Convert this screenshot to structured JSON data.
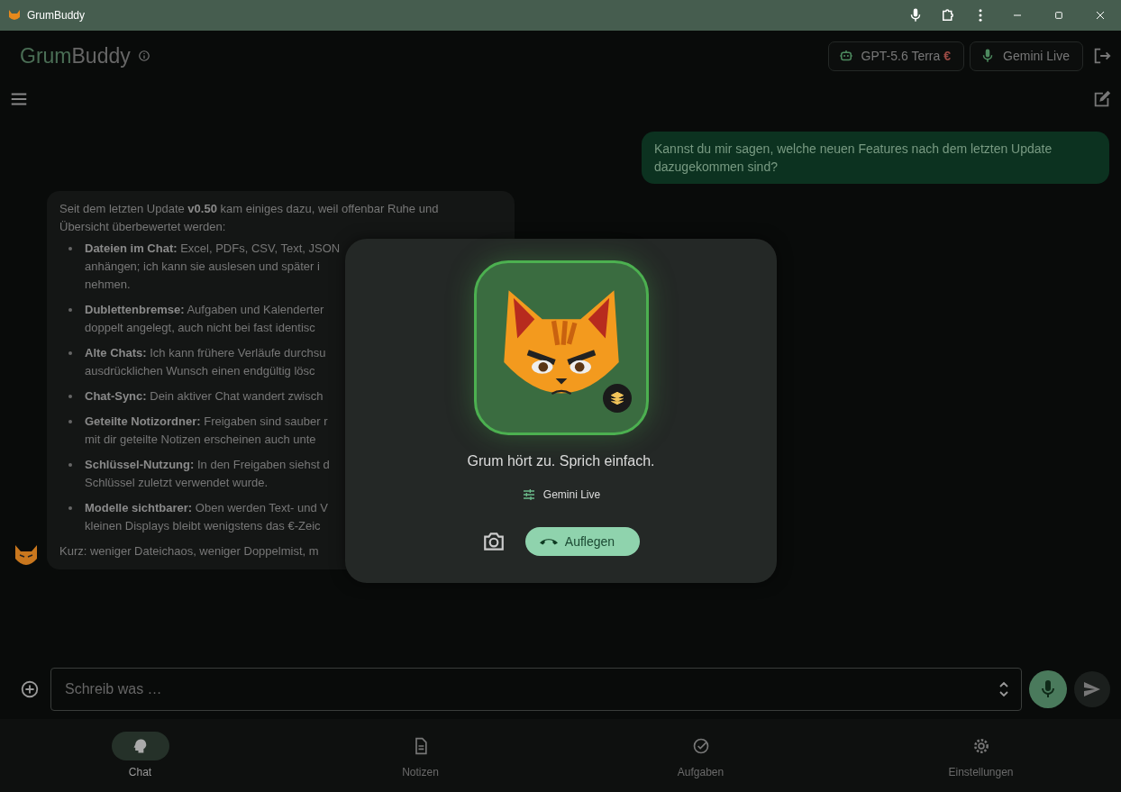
{
  "window": {
    "title": "GrumBuddy"
  },
  "header": {
    "logo_first": "Grum",
    "logo_second": "Buddy",
    "model_chip": {
      "label": "GPT-5.6 Terra",
      "currency": "€"
    },
    "voice_chip": {
      "label": "Gemini Live"
    }
  },
  "chat": {
    "user_message": "Kannst du mir sagen, welche neuen Features nach dem letzten Update dazugekommen sind?",
    "bot_message": {
      "intro": [
        "Seit dem letzten Update **v0.50** kam einiges dazu, weil offenbar Ruhe und",
        "Übersicht überbewertet werden:"
      ],
      "items": [
        {
          "lines": [
            "**Dateien im Chat:** Excel, PDFs, CSV, Text, JSON",
            "anhängen; ich kann sie auslesen und später i",
            "nehmen."
          ]
        },
        {
          "lines": [
            "**Dublettenbremse:** Aufgaben und Kalenderter",
            "doppelt angelegt, auch nicht bei fast identisc"
          ]
        },
        {
          "lines": [
            "**Alte Chats:** Ich kann frühere Verläufe durchsu",
            "ausdrücklichen Wunsch einen endgültig lösc"
          ]
        },
        {
          "lines": [
            "**Chat-Sync:** Dein aktiver Chat wandert zwisch"
          ]
        },
        {
          "lines": [
            "**Geteilte Notizordner:** Freigaben sind sauber r",
            "mit dir geteilte Notizen erscheinen auch unte"
          ]
        },
        {
          "lines": [
            "**Schlüssel-Nutzung:** In den Freigaben siehst d",
            "Schlüssel zuletzt verwendet wurde."
          ]
        },
        {
          "lines": [
            "**Modelle sichtbarer:** Oben werden Text- und V",
            "kleinen Displays bleibt wenigstens das €-Zeic"
          ]
        }
      ],
      "outro": "Kurz: weniger Dateichaos, weniger Doppelmist, m"
    }
  },
  "voice_dialog": {
    "status": "Grum hört zu. Sprich einfach.",
    "model": "Gemini Live",
    "hangup": "Auflegen"
  },
  "composer": {
    "placeholder": "Schreib was …"
  },
  "nav": [
    {
      "kind": "chat",
      "label": "Chat",
      "selected": true
    },
    {
      "kind": "notes",
      "label": "Notizen",
      "selected": false
    },
    {
      "kind": "tasks",
      "label": "Aufgaben",
      "selected": false
    },
    {
      "kind": "settings",
      "label": "Einstellungen",
      "selected": false
    }
  ]
}
